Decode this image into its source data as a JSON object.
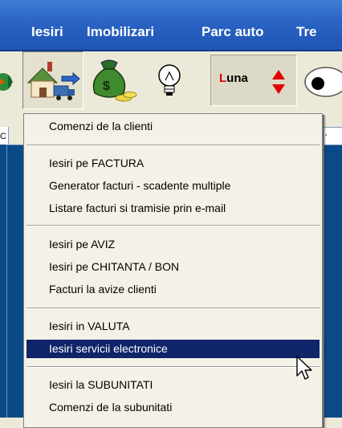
{
  "menubar": {
    "items": [
      "Iesiri",
      "Imobilizari",
      "Parc auto",
      "Tre"
    ]
  },
  "toolbar": {
    "buttons": [
      {
        "icon": "arrows-icon"
      },
      {
        "icon": "house-truck-icon",
        "pressed": true
      },
      {
        "icon": "money-bag-icon"
      },
      {
        "icon": "lightbulb-icon"
      }
    ],
    "period_first_letter": "L",
    "period_rest": "una",
    "colors": {
      "menubar": "#2a63c4",
      "luna_letter": "#e00000",
      "highlight": "#10246a",
      "workspace": "#0a4a88"
    }
  },
  "field": {
    "left_value": "C",
    "right_value": ".."
  },
  "menu": {
    "groups": [
      [
        "Comenzi de la clienti"
      ],
      [
        "Iesiri pe FACTURA",
        "Generator facturi - scadente multiple",
        "Listare facturi si tramisie prin e-mail"
      ],
      [
        "Iesiri pe AVIZ",
        "Iesiri pe CHITANTA / BON",
        "Facturi la avize clienti"
      ],
      [
        "Iesiri in VALUTA",
        "Iesiri servicii electronice"
      ],
      [
        "Iesiri la SUBUNITATI",
        "Comenzi de la subunitati"
      ]
    ],
    "highlighted": "Iesiri servicii electronice"
  }
}
